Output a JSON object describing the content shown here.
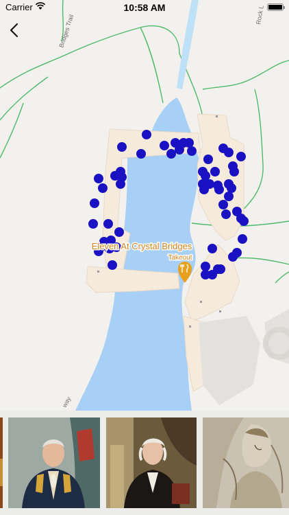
{
  "status": {
    "carrier": "Carrier",
    "time": "10:58 AM"
  },
  "nav": {
    "back_icon": "chevron-left-icon"
  },
  "map": {
    "place_name": "Eleven At Crystal Bridges",
    "place_subtitle": "Takeout",
    "poi_icon": "restaurant-fork-knife-icon",
    "trail_label_top": "Bridges Trail",
    "trail_label_right": "Rock L",
    "trail_label_bottom": "way",
    "colors": {
      "water": "#a8cff5",
      "building": "#f6eadd",
      "trail": "#4fb96a",
      "marker": "#1a12c2",
      "poi": "#e8a11c"
    }
  },
  "gallery": {
    "items": [
      {
        "name": "partial-painting-left",
        "kind": "painting"
      },
      {
        "name": "george-washington-military-portrait",
        "kind": "painting"
      },
      {
        "name": "george-washington-standing-portrait",
        "kind": "painting"
      },
      {
        "name": "figure-sketch-painting",
        "kind": "painting"
      }
    ]
  }
}
